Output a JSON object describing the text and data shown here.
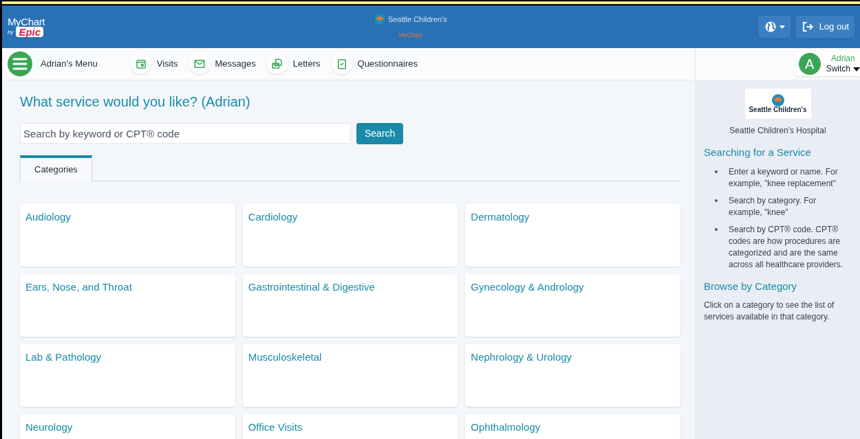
{
  "header": {
    "brand_top": "MyChart",
    "brand_by": "by",
    "brand_bottom": "Epic",
    "center_org": "Seattle Children's",
    "center_app": "MyChart",
    "logout": "Log out"
  },
  "nav": {
    "menu": "Adrian's Menu",
    "items": [
      {
        "label": "Visits",
        "kind": "calendar"
      },
      {
        "label": "Messages",
        "kind": "envelope"
      },
      {
        "label": "Letters",
        "kind": "letter"
      },
      {
        "label": "Questionnaires",
        "kind": "clipboard"
      }
    ],
    "user": {
      "initial": "A",
      "name": "Adrian",
      "action": "Switch"
    }
  },
  "main": {
    "title": "What service would you like? (Adrian)",
    "search": {
      "placeholder": "Search by keyword or CPT® code",
      "button": "Search"
    },
    "tabs": [
      {
        "label": "Categories",
        "selected": true
      }
    ],
    "categories": [
      "Audiology",
      "Cardiology",
      "Dermatology",
      "Ears, Nose, and Throat",
      "Gastrointestinal & Digestive",
      "Gynecology & Andrology",
      "Lab & Pathology",
      "Musculoskeletal",
      "Nephrology & Urology",
      "Neurology",
      "Office Visits",
      "Ophthalmology"
    ]
  },
  "sidebar": {
    "logo_name": "Seattle Children's",
    "org": "Seattle Children's Hospital",
    "sections": [
      {
        "title": "Searching for a Service",
        "bullets": [
          "Enter a keyword or name. For example, \"knee replacement\"",
          "Search by category. For example, \"knee\"",
          "Search by CPT® code. CPT® codes are how procedures are categorized and are the same across all healthcare providers."
        ]
      },
      {
        "title": "Browse by Category",
        "text": "Click on a category to see the list of services available in that category."
      }
    ]
  }
}
